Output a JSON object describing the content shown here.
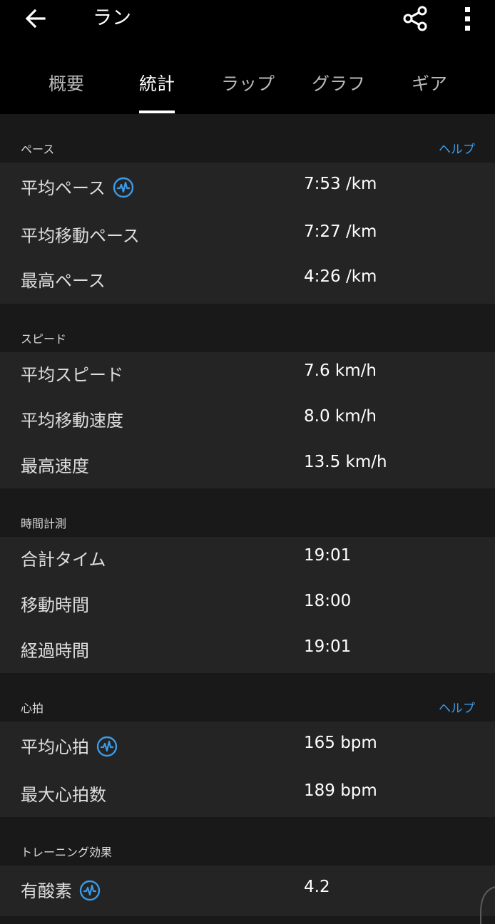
{
  "header": {
    "title": "ラン"
  },
  "tabs": [
    {
      "label": "概要"
    },
    {
      "label": "統計"
    },
    {
      "label": "ラップ"
    },
    {
      "label": "グラフ"
    },
    {
      "label": "ギア"
    }
  ],
  "active_tab_index": 1,
  "colors": {
    "accent": "#3b9be8",
    "background": "#191919",
    "card": "#242424",
    "appbar": "#000000"
  },
  "icons": {
    "back": "arrow-left-icon",
    "share": "share-icon",
    "more": "more-vert-icon",
    "heart_rate": "heart-rate-monitor-icon"
  },
  "sections": {
    "pace": {
      "title": "ペース",
      "help": "ヘルプ",
      "rows": [
        {
          "label": "平均ペース",
          "value": "7:53 /km"
        },
        {
          "label": "平均移動ペース",
          "value": "7:27 /km"
        },
        {
          "label": "最高ペース",
          "value": "4:26 /km"
        }
      ]
    },
    "speed": {
      "title": "スピード",
      "rows": [
        {
          "label": "平均スピード",
          "value": "7.6 km/h"
        },
        {
          "label": "平均移動速度",
          "value": "8.0 km/h"
        },
        {
          "label": "最高速度",
          "value": "13.5 km/h"
        }
      ]
    },
    "timing": {
      "title": "時間計測",
      "rows": [
        {
          "label": "合計タイム",
          "value": "19:01"
        },
        {
          "label": "移動時間",
          "value": "18:00"
        },
        {
          "label": "経過時間",
          "value": "19:01"
        }
      ]
    },
    "heart_rate": {
      "title": "心拍",
      "help": "ヘルプ",
      "rows": [
        {
          "label": "平均心拍",
          "value": "165 bpm"
        },
        {
          "label": "最大心拍数",
          "value": "189 bpm"
        }
      ]
    },
    "training_effect": {
      "title": "トレーニング効果",
      "rows": [
        {
          "label": "有酸素",
          "value": "4.2"
        }
      ]
    }
  }
}
